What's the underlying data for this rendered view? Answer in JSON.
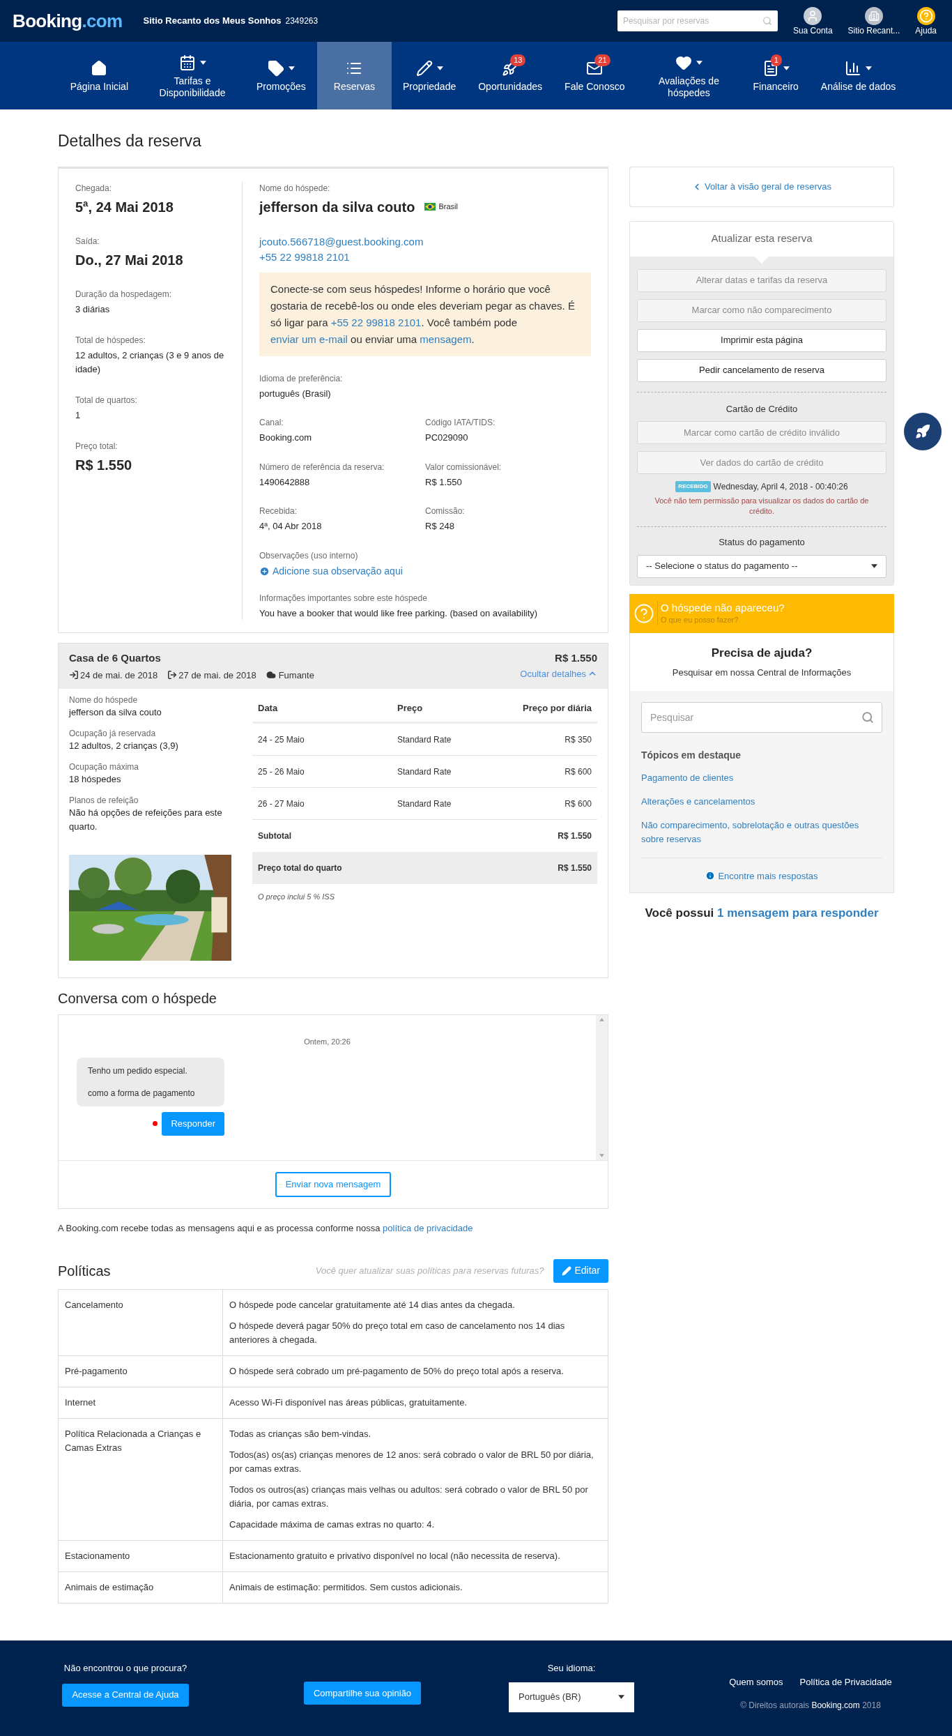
{
  "topbar": {
    "logo": {
      "main": "Booking",
      "suffix": ".com"
    },
    "property_name": "Sitio Recanto dos Meus Sonhos",
    "property_id": "2349263",
    "search": {
      "placeholder": "Pesquisar por reservas"
    },
    "accounts": [
      {
        "label": "Sua Conta",
        "kind": "user"
      },
      {
        "label": "Sitio Recant...",
        "kind": "property"
      },
      {
        "label": "Ajuda",
        "kind": "help"
      }
    ]
  },
  "nav": [
    {
      "label": "Página Inicial",
      "dropdown": false,
      "selected": false
    },
    {
      "label": "Tarifas e Disponibilidade",
      "dropdown": true,
      "selected": false
    },
    {
      "label": "Promoções",
      "dropdown": true,
      "selected": false
    },
    {
      "label": "Reservas",
      "dropdown": false,
      "selected": true
    },
    {
      "label": "Propriedade",
      "dropdown": true,
      "selected": false
    },
    {
      "label": "Oportunidades",
      "dropdown": false,
      "selected": false,
      "badge": "13"
    },
    {
      "label": "Fale Conosco",
      "dropdown": false,
      "selected": false,
      "badge": "21"
    },
    {
      "label": "Avaliações de hóspedes",
      "dropdown": true,
      "selected": false
    },
    {
      "label": "Financeiro",
      "dropdown": true,
      "selected": false,
      "badge": "1"
    },
    {
      "label": "Análise de dados",
      "dropdown": true,
      "selected": false
    }
  ],
  "page_title": "Detalhes da reserva",
  "stay": [
    {
      "label": "Chegada:",
      "value": "5ª, 24 Mai 2018",
      "kind": "large"
    },
    {
      "label": "Saída:",
      "value": "Do., 27 Mai 2018",
      "kind": "large"
    },
    {
      "label": "Duração da hospedagem:",
      "value": "3 diárias",
      "kind": "normal"
    },
    {
      "label": "Total de hóspedes:",
      "value": "12 adultos, 2 crianças (3 e 9 anos de idade)",
      "kind": "normal"
    },
    {
      "label": "Total de quartos:",
      "value": "1",
      "kind": "normal"
    },
    {
      "label": "Preço total:",
      "value": "R$ 1.550",
      "kind": "large"
    }
  ],
  "guest": {
    "label": "Nome do hóspede:",
    "name": "jefferson da silva couto",
    "country": "Brasil",
    "email": "jcouto.566718@guest.booking.com",
    "phone": "+55 22 99818 2101",
    "notice": [
      {
        "text": "Conecte-se com seus hóspedes! Informe o horário que você gostaria de recebê-los ou onde eles deveriam pegar as chaves. É só ligar para ",
        "link": false
      },
      {
        "text": "+55 22 99818 2101",
        "link": true
      },
      {
        "text": ". Você também pode ",
        "link": false
      },
      {
        "text": "enviar um e-mail",
        "link": true
      },
      {
        "text": " ou enviar uma ",
        "link": false
      },
      {
        "text": "mensagem",
        "link": true
      },
      {
        "text": ".",
        "link": false
      }
    ],
    "language": {
      "label": "Idioma de preferência:",
      "value": "português (Brasil)"
    },
    "fields": [
      {
        "label": "Canal:",
        "value": "Booking.com"
      },
      {
        "label": "Código IATA/TIDS:",
        "value": "PC029090"
      },
      {
        "label": "Número de referência da reserva:",
        "value": "1490642888"
      },
      {
        "label": "Valor comissionável:",
        "value": "R$ 1.550"
      },
      {
        "label": "Recebida:",
        "value": "4ª, 04 Abr 2018"
      },
      {
        "label": "Comissão:",
        "value": "R$ 248"
      }
    ],
    "notes": {
      "label": "Observações (uso interno)",
      "action": "Adicione sua observação aqui"
    },
    "important": {
      "label": "Informações importantes sobre este hóspede",
      "value": "You have a booker that would like free parking. (based on availability)"
    }
  },
  "room": {
    "name": "Casa de 6 Quartos",
    "checkin": "24 de mai. de 2018",
    "checkout": "27 de mai. de 2018",
    "smoking": "Fumante",
    "price": "R$ 1.550",
    "toggle": "Ocultar detalhes",
    "expanded": true,
    "info": [
      {
        "label": "Nome do hóspede",
        "value": "jefferson da silva couto"
      },
      {
        "label": "Ocupação já reservada",
        "value": "12 adultos, 2 crianças (3,9)"
      },
      {
        "label": "Ocupação máxima",
        "value": "18 hóspedes"
      },
      {
        "label": "Planos de refeição",
        "value": "Não há opções de refeições para este quarto."
      }
    ],
    "table": {
      "columns": [
        "Data",
        "Preço",
        "Preço por diária"
      ],
      "rows": [
        [
          "24 - 25 Maio",
          "Standard Rate",
          "R$ 350"
        ],
        [
          "25 - 26 Maio",
          "Standard Rate",
          "R$ 600"
        ],
        [
          "26 - 27 Maio",
          "Standard Rate",
          "R$ 600"
        ]
      ],
      "subtotal": {
        "label": "Subtotal",
        "value": "R$ 1.550"
      },
      "total": {
        "label": "Preço total do quarto",
        "value": "R$ 1.550"
      },
      "note": "O preço inclui 5 % ISS"
    }
  },
  "conversation": {
    "title": "Conversa com o hóspede",
    "messages": [
      {
        "time": "Ontem, 20:26",
        "lines": [
          "Tenho um pedido especial.",
          "como a forma de pagamento"
        ],
        "reply": "Responder",
        "unread": true
      }
    ],
    "new_message": "Enviar nova mensagem",
    "privacy": [
      {
        "text": "A Booking.com recebe todas as mensagens aqui e as processa conforme nossa ",
        "link": false
      },
      {
        "text": "política de privacidade",
        "link": true
      }
    ]
  },
  "policies": {
    "title": "Políticas",
    "hint": "Você quer atualizar suas políticas para reservas futuras?",
    "edit": "Editar",
    "rows": [
      {
        "label": "Cancelamento",
        "paragraphs": [
          "O hóspede pode cancelar gratuitamente até 14 dias antes da chegada.",
          "O hóspede deverá pagar 50% do preço total em caso de cancelamento nos 14 dias anteriores à chegada."
        ]
      },
      {
        "label": "Pré-pagamento",
        "paragraphs": [
          "O hóspede será cobrado um pré-pagamento de 50% do preço total após a reserva."
        ]
      },
      {
        "label": "Internet",
        "paragraphs": [
          "Acesso Wi-Fi disponível nas áreas públicas, gratuitamente."
        ]
      },
      {
        "label": "Política Relacionada a Crianças e Camas Extras",
        "paragraphs": [
          "Todas as crianças são bem-vindas.",
          "Todos(as) os(as) crianças menores de 12 anos: será cobrado o valor de BRL 50 por diária, por camas extras.",
          "Todos os outros(as) crianças mais velhas ou adultos: será cobrado o valor de BRL 50 por diária, por camas extras.",
          "Capacidade máxima de camas extras no quarto: 4."
        ]
      },
      {
        "label": "Estacionamento",
        "paragraphs": [
          "Estacionamento gratuito e privativo disponível no local (não necessita de reserva)."
        ]
      },
      {
        "label": "Animais de estimação",
        "paragraphs": [
          "Animais de estimação: permitidos. Sem custos adicionais."
        ]
      }
    ]
  },
  "sidebar": {
    "back": "Voltar à visão geral de reservas",
    "update": {
      "title": "Atualizar esta reserva",
      "actions": [
        {
          "label": "Alterar datas e tarifas da reserva",
          "disabled": true
        },
        {
          "label": "Marcar como não comparecimento",
          "disabled": true
        },
        {
          "label": "Imprimir esta página",
          "disabled": false
        },
        {
          "label": "Pedir cancelamento de reserva",
          "disabled": false
        }
      ],
      "card": {
        "title": "Cartão de Crédito",
        "actions": [
          {
            "label": "Marcar como cartão de crédito inválido",
            "disabled": true
          },
          {
            "label": "Ver dados do cartão de crédito",
            "disabled": true
          }
        ],
        "badge": "RECEBIDO",
        "received": "Wednesday, April 4, 2018 - 00:40:26",
        "warning": "Você não tem permissão para visualizar os dados do cartão de crédito."
      },
      "payment": {
        "label": "Status do pagamento",
        "value": "-- Selecione o status do pagamento --"
      }
    },
    "no_show": {
      "title": "O hóspede não apareceu?",
      "link": "O que eu posso fazer?"
    },
    "help": {
      "title": "Precisa de ajuda?",
      "subtitle": "Pesquisar em nossa Central de Informações",
      "search": {
        "placeholder": "Pesquisar"
      },
      "topics_title": "Tópicos em destaque",
      "topics": [
        "Pagamento de clientes",
        "Alterações e cancelamentos",
        "Não comparecimento, sobrelotação e outras questões sobre reservas"
      ],
      "more": "Encontre mais respostas"
    },
    "messages_note": [
      {
        "text": "Você possui ",
        "link": false
      },
      {
        "text": "1 mensagem para responder",
        "link": true
      }
    ]
  },
  "footer": {
    "question": "Não encontrou o que procura?",
    "help_button": "Acesse a Central de Ajuda",
    "feedback_button": "Compartilhe sua opinião",
    "language": {
      "label": "Seu idioma:",
      "value": "Português (BR)"
    },
    "links": [
      "Quem somos",
      "Política de Privacidade"
    ],
    "copyright": {
      "prefix": "© Direitos autorais",
      "brand": "Booking.com",
      "year": "2018"
    }
  }
}
